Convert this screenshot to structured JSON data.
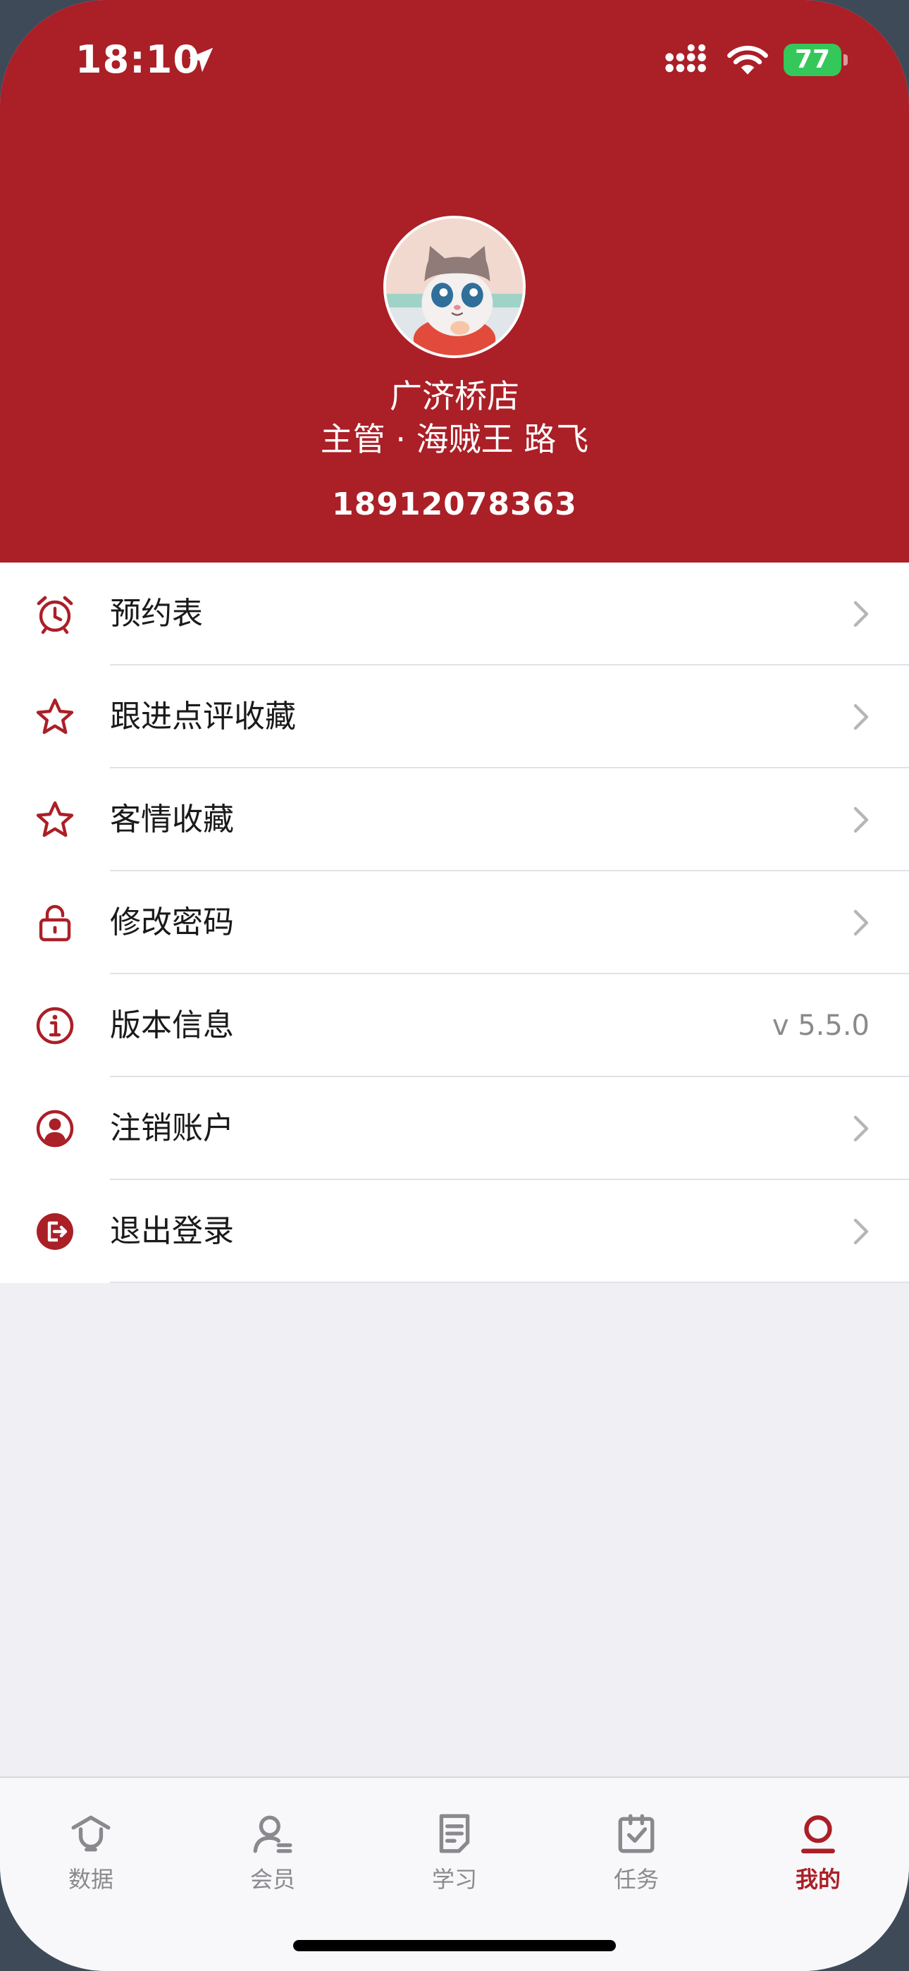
{
  "status_bar": {
    "time": "18:10",
    "battery": "77",
    "icons": [
      "location-arrow-icon",
      "cellular-signal-icon",
      "wifi-icon",
      "battery-charging-icon"
    ]
  },
  "profile": {
    "store": "广济桥店",
    "role": "主管 · 海贼王 路飞",
    "phone": "18912078363",
    "avatar_icon": "cartoon-cat-avatar"
  },
  "menu": {
    "items": [
      {
        "label": "预约表",
        "icon": "alarm-clock-icon"
      },
      {
        "label": "跟进点评收藏",
        "icon": "star-icon"
      },
      {
        "label": "客情收藏",
        "icon": "star-icon"
      },
      {
        "label": "修改密码",
        "icon": "lock-icon"
      },
      {
        "label": "版本信息",
        "icon": "info-icon",
        "value": "v 5.5.0"
      },
      {
        "label": "注销账户",
        "icon": "user-circle-icon"
      },
      {
        "label": "退出登录",
        "icon": "logout-icon"
      }
    ]
  },
  "tabbar": {
    "tabs": [
      {
        "label": "数据",
        "icon": "data-home-icon",
        "active": false
      },
      {
        "label": "会员",
        "icon": "member-icon",
        "active": false
      },
      {
        "label": "学习",
        "icon": "document-icon",
        "active": false
      },
      {
        "label": "任务",
        "icon": "task-check-icon",
        "active": false
      },
      {
        "label": "我的",
        "icon": "profile-icon",
        "active": true
      }
    ]
  },
  "colors": {
    "brand": "#ab1f27",
    "background": "#efeff4",
    "tab_inactive": "#8a8a8e"
  }
}
